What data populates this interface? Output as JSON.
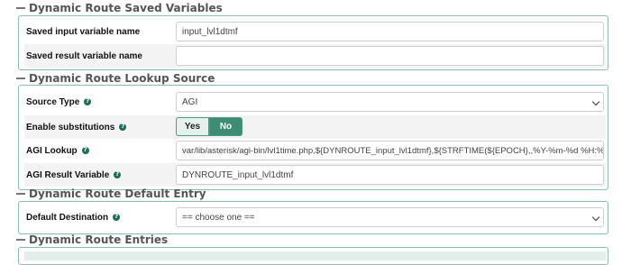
{
  "saved_variables": {
    "title": "Dynamic Route Saved Variables",
    "input_var_label": "Saved input variable name",
    "input_var_value": "input_lvl1dtmf",
    "result_var_label": "Saved result variable name",
    "result_var_value": ""
  },
  "lookup_source": {
    "title": "Dynamic Route Lookup Source",
    "source_type_label": "Source Type",
    "source_type_value": "AGI",
    "substitutions_label": "Enable substitutions",
    "substitutions_yes": "Yes",
    "substitutions_no": "No",
    "substitutions_selected": "No",
    "agi_lookup_label": "AGI Lookup",
    "agi_lookup_value": "var/lib/asterisk/agi-bin/lvl1time.php,${DYNROUTE_input_lvl1dtmf},${STRFTIME(${EPOCH},,%Y-%m-%d %H:%M:%S)}",
    "agi_result_label": "AGI Result Variable",
    "agi_result_value": "DYNROUTE_input_lvl1dtmf"
  },
  "default_entry": {
    "title": "Dynamic Route Default Entry",
    "default_dest_label": "Default Destination",
    "default_dest_value": "== choose one =="
  },
  "entries": {
    "title": "Dynamic Route Entries"
  },
  "colors": {
    "accent": "#3d8c73",
    "panel_border": "#8dbdb0",
    "help_icon": "#1c6d5e"
  }
}
